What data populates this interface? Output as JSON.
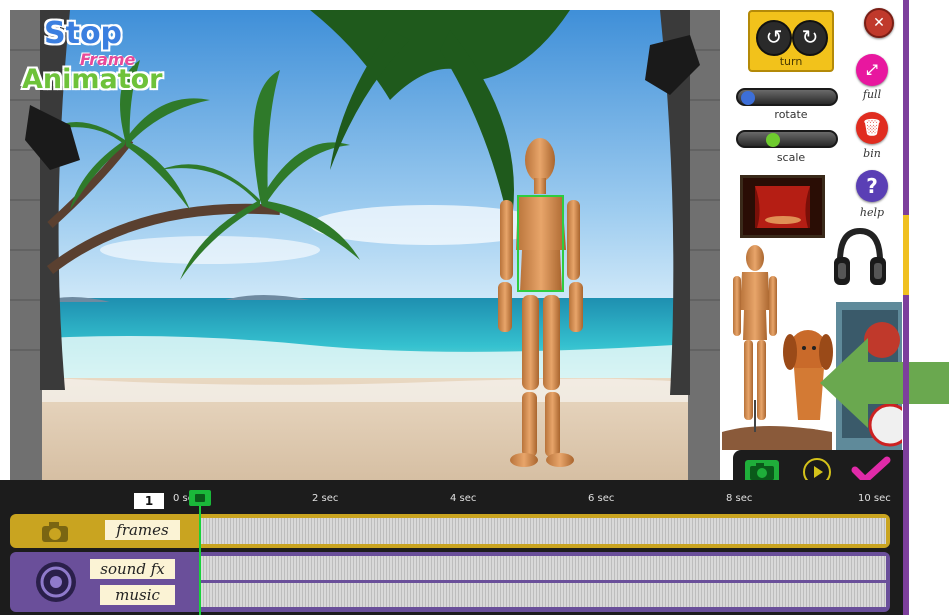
{
  "app": {
    "logo_line1": "Stop",
    "logo_line2": "Frame",
    "logo_line3": "Animator"
  },
  "controls": {
    "turn_label": "turn",
    "rotate_label": "rotate",
    "scale_label": "scale",
    "full_label": "full",
    "bin_label": "bin",
    "help_label": "help"
  },
  "timeline": {
    "current_frame": "1",
    "ticks": [
      "0 sec",
      "2 sec",
      "4 sec",
      "6 sec",
      "8 sec",
      "10 sec"
    ],
    "frames_label": "frames",
    "sound_fx_label": "sound fx",
    "music_label": "music"
  },
  "colors": {
    "turn_box": "#f2c21b",
    "frames_track": "#c9a420",
    "sound_track": "#6a4f9a",
    "arrow": "#6aa84f",
    "playhead": "#1ab83a",
    "selection": "#2ecc40"
  }
}
